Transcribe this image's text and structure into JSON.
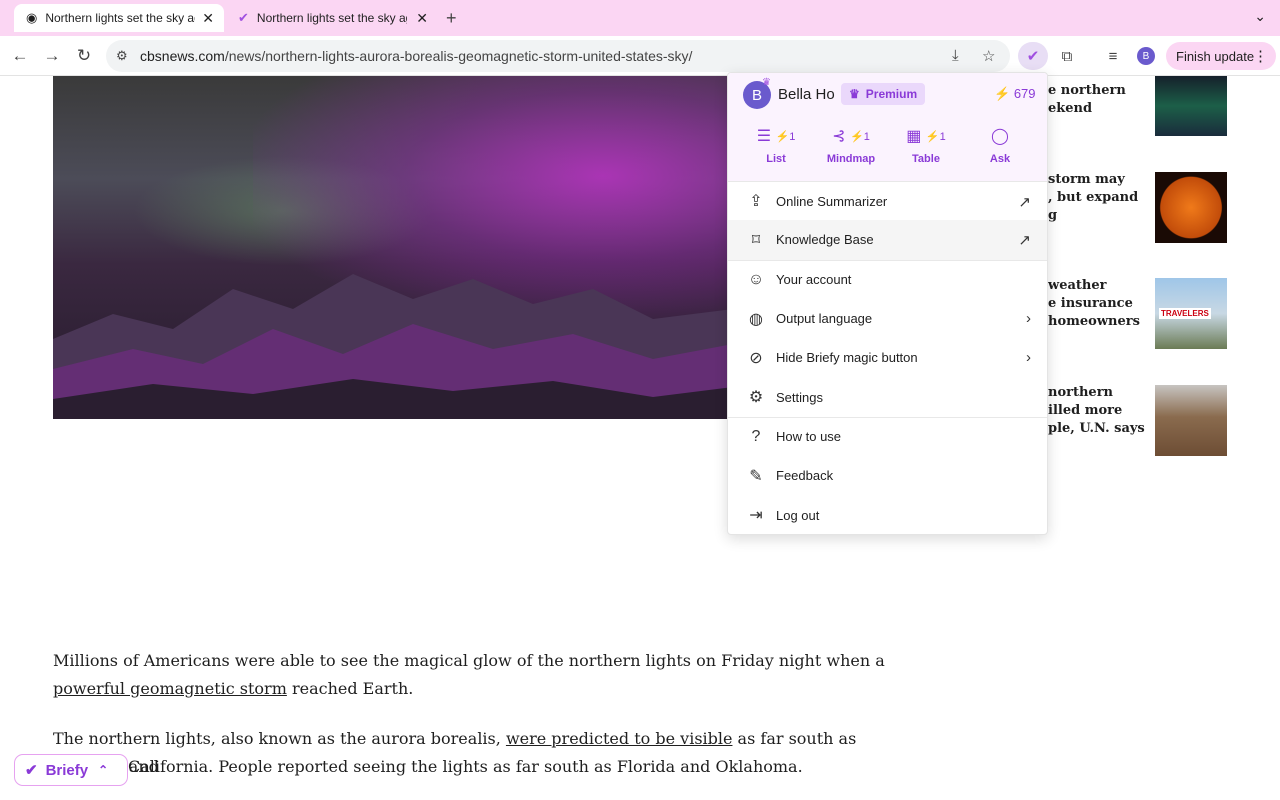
{
  "browser": {
    "tabs": [
      {
        "title": "Northern lights set the sky ag",
        "active": true
      },
      {
        "title": "Northern lights set the sky ag",
        "active": false
      }
    ],
    "url_domain": "cbsnews.com",
    "url_path": "/news/northern-lights-aurora-borealis-geomagnetic-storm-united-states-sky/",
    "profile_initial": "B",
    "finish_update_label": "Finish update"
  },
  "icons": {
    "tab_favicon": "cbs-eye-icon",
    "tab2_favicon": "briefy-icon",
    "close": "✕",
    "new_tab": "+",
    "tab_menu": "⌄",
    "back": "←",
    "forward": "→",
    "reload": "↻",
    "site_settings": "⚙",
    "install": "⤓",
    "star": "☆",
    "extension_briefy": "✔",
    "extensions": "⧉",
    "media": "≡",
    "more": "⋮",
    "lightning": "⚡",
    "crown": "♛",
    "list": "☰",
    "mindmap": "⊰",
    "table": "▦",
    "ask": "◯",
    "upload": "⇪",
    "bookmark": "⌑",
    "external": "↗",
    "person": "☺",
    "globe": "◍",
    "hide": "⊘",
    "chevron_right": "›",
    "gear": "⚙",
    "help": "?",
    "edit": "✎",
    "logout": "⇥",
    "chevron_up": "⌃"
  },
  "sidebar_articles": [
    {
      "lines": [
        "e northern",
        "ekend"
      ]
    },
    {
      "lines": [
        "storm may",
        ", but expand",
        "g"
      ]
    },
    {
      "lines": [
        "weather",
        "e insurance",
        "homeowners"
      ]
    },
    {
      "lines": [
        "northern",
        "illed more",
        "ple, U.N. says"
      ]
    }
  ],
  "thumb3_sign": "TRAVELERS",
  "article": {
    "p1_before": "Millions of Americans were able to see the magical glow of the northern lights on Friday night when a ",
    "p1_link": "powerful geomagnetic storm",
    "p1_after": " reached Earth.",
    "p2_before": "The northern lights, also known as the aurora borealis, ",
    "p2_link": "were predicted to be visible",
    "p2_after": " as far south as Alabama and",
    "p3": "California. People reported seeing the lights as far south as Florida and Oklahoma."
  },
  "briefy_fab": {
    "label": "Briefy"
  },
  "popup": {
    "avatar_initial": "B",
    "user_name": "Bella Ho",
    "premium_label": "Premium",
    "credits": "679",
    "actions": [
      {
        "label": "List",
        "badge": "1"
      },
      {
        "label": "Mindmap",
        "badge": "1"
      },
      {
        "label": "Table",
        "badge": "1"
      },
      {
        "label": "Ask",
        "badge": ""
      }
    ],
    "menu": [
      {
        "label": "Online Summarizer"
      },
      {
        "label": "Knowledge Base"
      },
      {
        "label": "Your account"
      },
      {
        "label": "Output language"
      },
      {
        "label": "Hide Briefy magic button"
      },
      {
        "label": "Settings"
      },
      {
        "label": "How to use"
      },
      {
        "label": "Feedback"
      },
      {
        "label": "Log out"
      }
    ]
  }
}
